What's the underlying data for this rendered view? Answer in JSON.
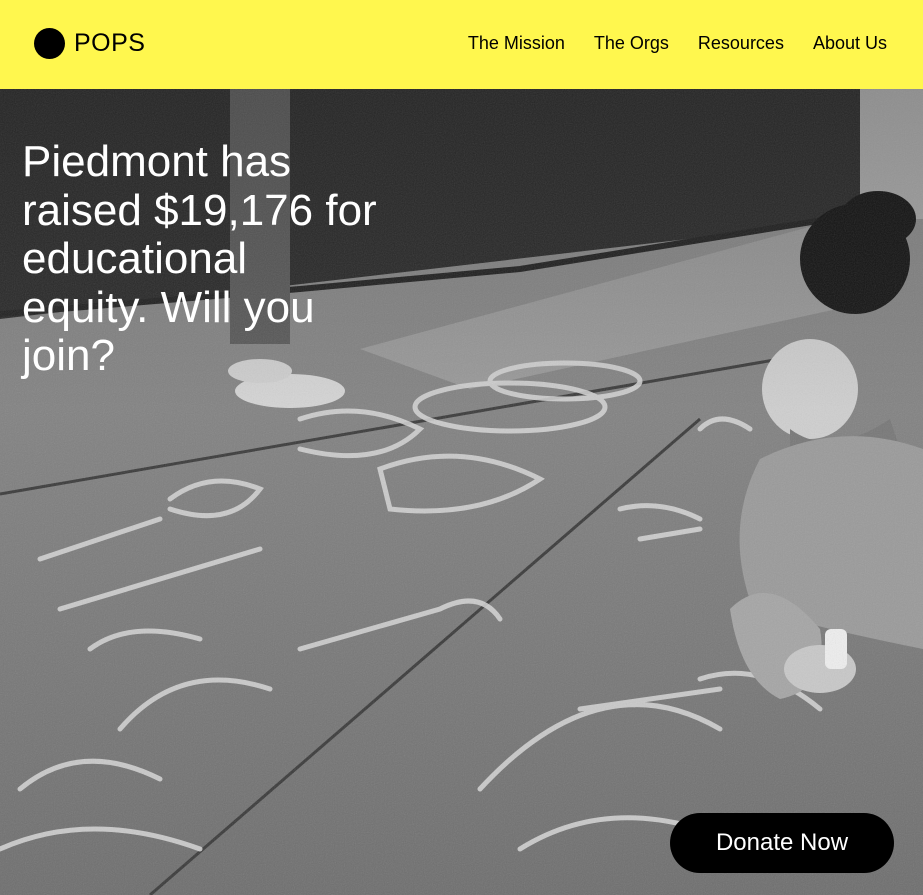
{
  "brand": {
    "name": "POPS"
  },
  "nav": {
    "items": [
      "The Mission",
      "The Orgs",
      "Resources",
      "About Us"
    ]
  },
  "hero": {
    "headline": "Piedmont has raised $19,176 for educational equity. Will you join?",
    "photo": "black-and-white photo of a child drawing with chalk on a sidewalk"
  },
  "cta": {
    "label": "Donate Now"
  },
  "colors": {
    "topbar": "#fff74e",
    "button": "#000000",
    "headline": "#ffffff"
  }
}
